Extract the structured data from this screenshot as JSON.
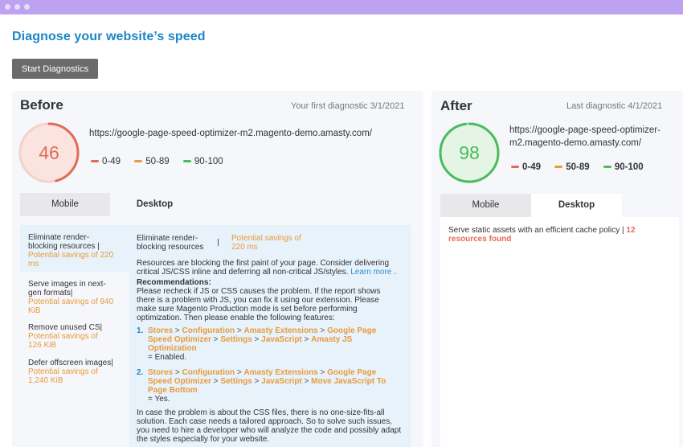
{
  "page": {
    "title": "Diagnose your website’s speed",
    "start_button": "Start Diagnostics"
  },
  "colors": {
    "accent": "#1c86c6",
    "low": "#e06b57",
    "mid": "#e99a3b",
    "high": "#4cbb5c",
    "titlebar": "#bda2f2"
  },
  "before": {
    "heading": "Before",
    "meta": "Your first diagnostic 3/1/2021",
    "score": "46",
    "score_value": 46,
    "url": "https://google-page-speed-optimizer-m2.magento-demo.amasty.com/",
    "legend": [
      "0-49",
      "50-89",
      "90-100"
    ],
    "tabs": {
      "mobile": "Mobile",
      "desktop": "Desktop"
    },
    "audits": [
      {
        "name": "Eliminate render-blocking resources |",
        "savings": "Potential savings of 220 ms"
      },
      {
        "name": "Serve images in next-gen formats|",
        "savings": "Potential savings of 940 KiB"
      },
      {
        "name": "Remove unused CS|",
        "savings": "Potential savings of 126 KiB"
      },
      {
        "name": "Defer offscreen images|",
        "savings": "Potential savings of 1,240 KiB"
      }
    ],
    "detail": {
      "title": "Eliminate render-blocking resources",
      "savings": "Potential savings of 220 ms",
      "desc": "Resources are blocking the first paint of your page. Consider delivering critical JS/CSS inline and deferring all non-critical JS/styles.",
      "learn_more": "Learn more",
      "rec_heading": "Recommendations:",
      "rec_text": "Please recheck if JS or CSS causes the problem. If the report shows there is a problem with JS, you can fix it using our extension. Please make sure Magento Production mode is set before performing optimization. Then please enable the following features:",
      "steps": [
        {
          "num": "1.",
          "path": [
            "Stores",
            "Configuration",
            "Amasty Extensions",
            "Google Page Speed Optimizer",
            "Settings",
            "JavaScript",
            "Amasty JS Optimization"
          ],
          "value": "= Enabled."
        },
        {
          "num": "2.",
          "path": [
            "Stores",
            "Configuration",
            "Amasty Extensions",
            "Google Page Speed Optimizer",
            "Settings",
            "JavaScript",
            "Move JavaScript To Page Bottom"
          ],
          "value": "= Yes."
        }
      ],
      "footer": "In case the problem is about the CSS files, there is no one-size-fits-all solution. Each case needs a tailored approach. So to solve such issues, you need to hire a developer who will analyze the code and possibly adapt the styles especially for your website."
    }
  },
  "after": {
    "heading": "After",
    "meta": "Last diagnostic 4/1/2021",
    "score": "98",
    "score_value": 98,
    "url": "https://google-page-speed-optimizer-m2.magento-demo.amasty.com/",
    "legend": [
      "0-49",
      "50-89",
      "90-100"
    ],
    "tabs": {
      "mobile": "Mobile",
      "desktop": "Desktop"
    },
    "audit": {
      "name": "Serve static assets with an efficient cache policy |",
      "count": "12 resources found"
    }
  }
}
